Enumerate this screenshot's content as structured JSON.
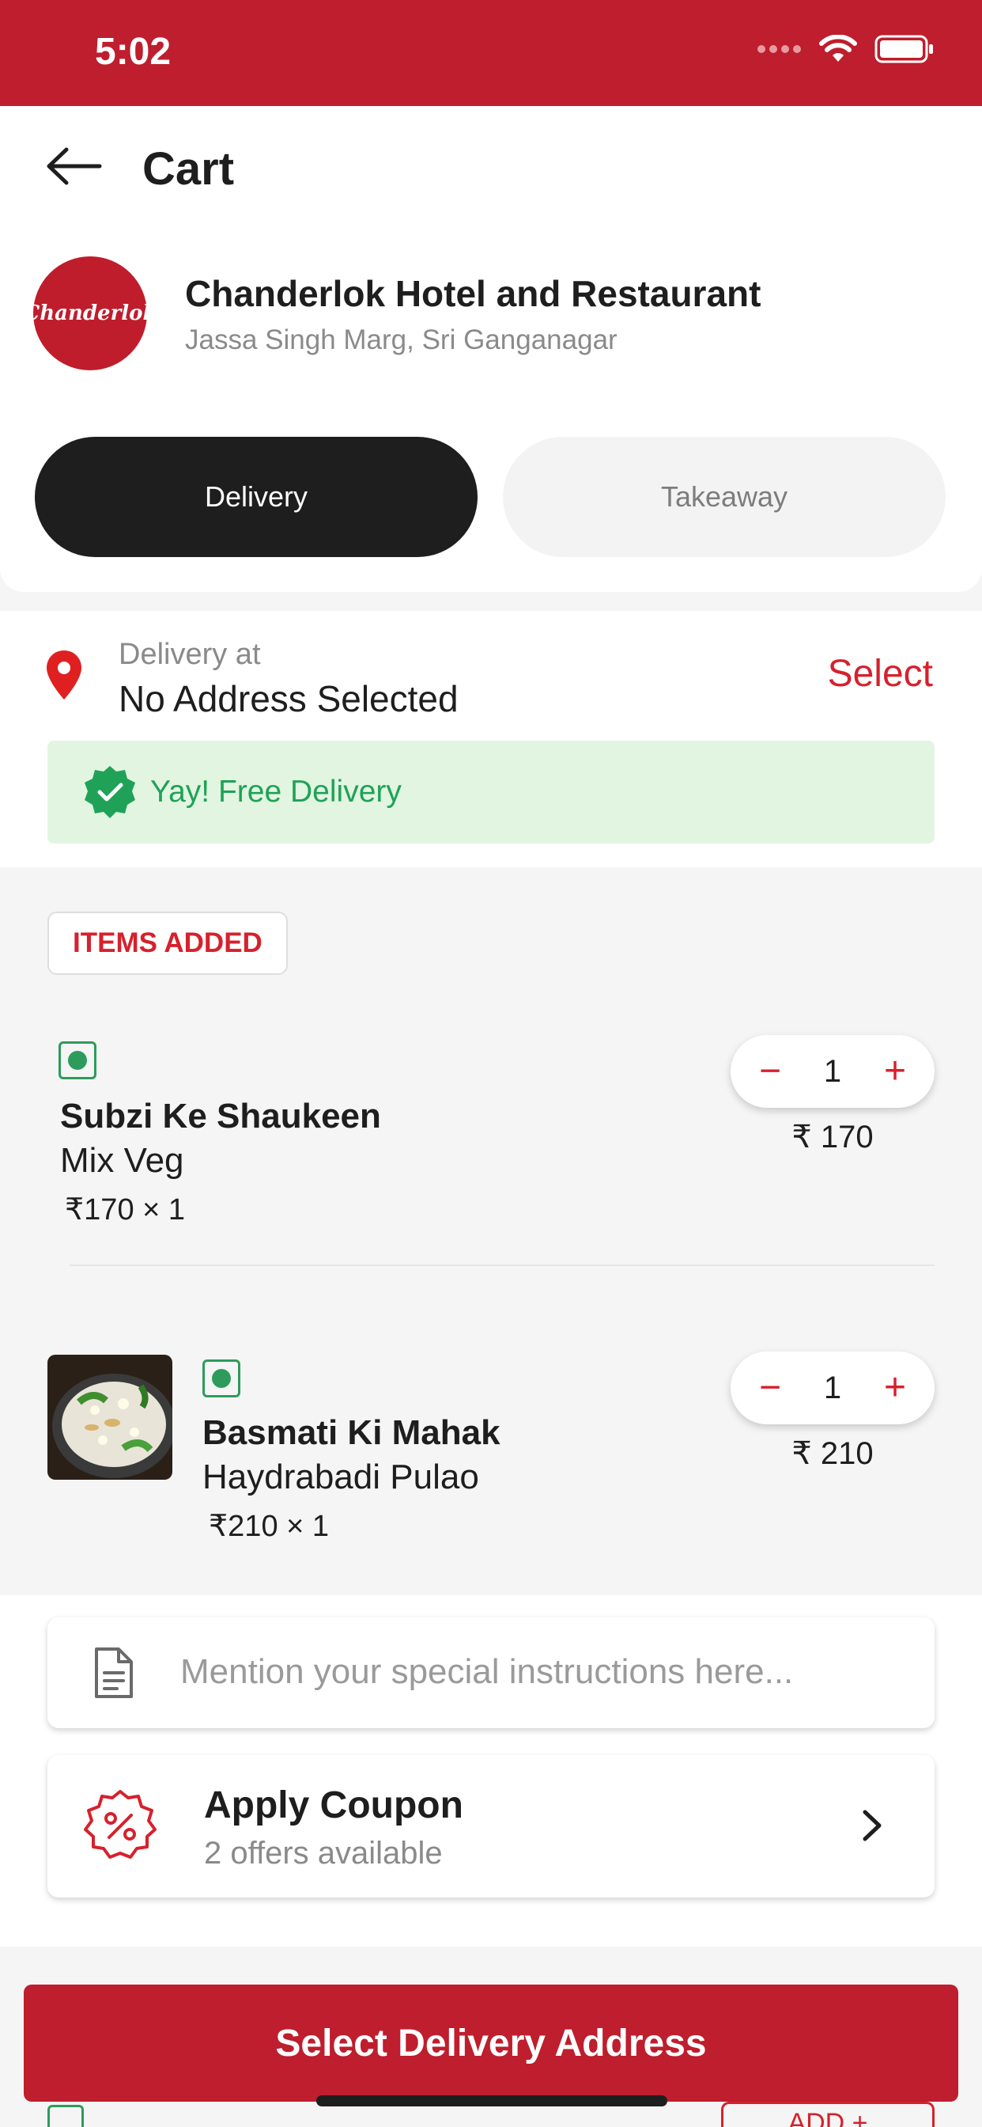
{
  "status_bar": {
    "time": "5:02"
  },
  "header": {
    "title": "Cart"
  },
  "restaurant": {
    "logo_text": "Chanderlok",
    "name": "Chanderlok Hotel and Restaurant",
    "address": "Jassa Singh Marg, Sri Ganganagar"
  },
  "order_mode": {
    "delivery_label": "Delivery",
    "takeaway_label": "Takeaway",
    "selected": "Delivery"
  },
  "delivery": {
    "label": "Delivery at",
    "value": "No Address Selected",
    "select_label": "Select",
    "free_delivery_text": "Yay! Free Delivery"
  },
  "items_header": "ITEMS ADDED",
  "items": [
    {
      "category": "Subzi Ke Shaukeen",
      "name": "Mix Veg",
      "unit_price": "₹170 × 1",
      "quantity": "1",
      "total": "₹ 170"
    },
    {
      "category": "Basmati Ki Mahak",
      "name": "Haydrabadi Pulao",
      "unit_price": "₹210 × 1",
      "quantity": "1",
      "total": "₹ 210"
    }
  ],
  "instructions": {
    "placeholder": "Mention your special instructions here..."
  },
  "coupon": {
    "title": "Apply Coupon",
    "subtitle": "2 offers available"
  },
  "cta": {
    "label": "Select Delivery Address"
  },
  "peek": {
    "add_label": "ADD +"
  },
  "colors": {
    "brand": "#be1e2d",
    "accent_red": "#d6212d",
    "veg_green": "#2e9b5c",
    "free_green": "#1fa257",
    "free_bg": "#e2f5e1"
  }
}
